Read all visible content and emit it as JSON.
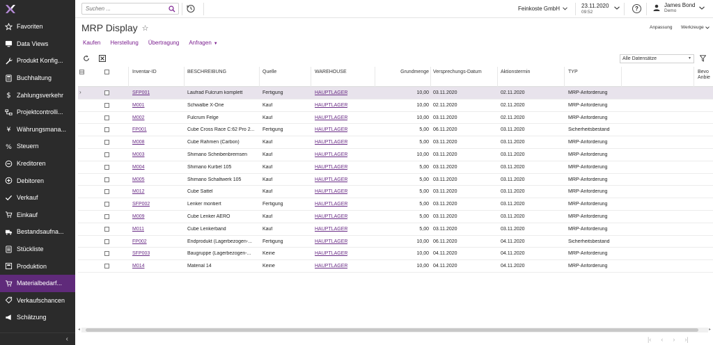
{
  "app": {
    "logo": "X"
  },
  "sidebar": {
    "items": [
      {
        "label": "Favoriten",
        "icon": "star-icon"
      },
      {
        "label": "Data Views",
        "icon": "monitor-icon"
      },
      {
        "label": "Produkt Konfig...",
        "icon": "wrench-icon"
      },
      {
        "label": "Buchhaltung",
        "icon": "calculator-icon"
      },
      {
        "label": "Zahlungsverkehr",
        "icon": "dollar-icon"
      },
      {
        "label": "Projektcontrolli...",
        "icon": "projects-icon"
      },
      {
        "label": "Währungsmana...",
        "icon": "currency-icon"
      },
      {
        "label": "Steuern",
        "icon": "percent-icon"
      },
      {
        "label": "Kreditoren",
        "icon": "minus-circle-icon"
      },
      {
        "label": "Debitoren",
        "icon": "plus-circle-icon"
      },
      {
        "label": "Verkauf",
        "icon": "check-tag-icon"
      },
      {
        "label": "Einkauf",
        "icon": "cart-icon"
      },
      {
        "label": "Bestandsaufna...",
        "icon": "truck-icon"
      },
      {
        "label": "Stückliste",
        "icon": "list-icon"
      },
      {
        "label": "Produktion",
        "icon": "factory-icon"
      },
      {
        "label": "Materialbedarf...",
        "icon": "cart-icon",
        "active": true
      },
      {
        "label": "Verkaufschancen",
        "icon": "tag-icon"
      },
      {
        "label": "Schätzung",
        "icon": "megaphone-icon"
      }
    ],
    "collapse": "‹"
  },
  "topbar": {
    "search_placeholder": "Suchen ...",
    "company": "Feinkoste GmbH",
    "date": "23.11.2020",
    "time": "09:52",
    "help": "?",
    "user_name": "James Bond",
    "user_role": "Demo"
  },
  "page": {
    "title": "MRP Display",
    "star": "☆",
    "links": {
      "customize": "Anpassung",
      "tools": "Werkzeuge"
    },
    "tabs": [
      {
        "label": "Kaufen"
      },
      {
        "label": "Herstellung"
      },
      {
        "label": "Übertragung"
      },
      {
        "label": "Anfragen",
        "dropdown": true
      }
    ],
    "filter_value": "Alle Datensätze"
  },
  "grid": {
    "columns": {
      "inventory_id": "Inventar-ID",
      "description": "BESCHREIBUNG",
      "source": "Quelle",
      "warehouse": "WAREHOUSE",
      "base_qty": "Grundmenge",
      "promise_date": "Versprechungs-Datum",
      "action_date": "Aktionstermin",
      "type": "TYP",
      "pref_line1": "Bevo",
      "pref_line2": "Anbie"
    },
    "rows": [
      {
        "id": "SFP001",
        "desc": "Laufrad Fulcrum komplett",
        "source": "Fertigung",
        "wh": "HAUPTLAGER",
        "qty": "10,00",
        "promise": "03.11.2020",
        "action": "02.11.2020",
        "type": "MRP-Anforderung"
      },
      {
        "id": "M001",
        "desc": "Schwalbe X-One",
        "source": "Kauf",
        "wh": "HAUPTLAGER",
        "qty": "10,00",
        "promise": "02.11.2020",
        "action": "02.11.2020",
        "type": "MRP-Anforderung"
      },
      {
        "id": "M002",
        "desc": "Fulcrum Felge",
        "source": "Kauf",
        "wh": "HAUPTLAGER",
        "qty": "10,00",
        "promise": "03.11.2020",
        "action": "02.11.2020",
        "type": "MRP-Anforderung"
      },
      {
        "id": "FP001",
        "desc": "Cube Cross Race C:62 Pro 2...",
        "source": "Fertigung",
        "wh": "HAUPTLAGER",
        "qty": "5,00",
        "promise": "06.11.2020",
        "action": "03.11.2020",
        "type": "Sicherheitsbestand"
      },
      {
        "id": "M008",
        "desc": "Cube Rahmen (Carbon)",
        "source": "Kauf",
        "wh": "HAUPTLAGER",
        "qty": "5,00",
        "promise": "03.11.2020",
        "action": "03.11.2020",
        "type": "MRP-Anforderung"
      },
      {
        "id": "M003",
        "desc": "Shimano Scheibenbremsen",
        "source": "Kauf",
        "wh": "HAUPTLAGER",
        "qty": "10,00",
        "promise": "03.11.2020",
        "action": "03.11.2020",
        "type": "MRP-Anforderung"
      },
      {
        "id": "M004",
        "desc": "Shimano Kurbel 105",
        "source": "Kauf",
        "wh": "HAUPTLAGER",
        "qty": "5,00",
        "promise": "03.11.2020",
        "action": "03.11.2020",
        "type": "MRP-Anforderung"
      },
      {
        "id": "M005",
        "desc": "Shimano Schaltwerk 105",
        "source": "Kauf",
        "wh": "HAUPTLAGER",
        "qty": "5,00",
        "promise": "03.11.2020",
        "action": "03.11.2020",
        "type": "MRP-Anforderung"
      },
      {
        "id": "M012",
        "desc": "Cube Sattel",
        "source": "Kauf",
        "wh": "HAUPTLAGER",
        "qty": "5,00",
        "promise": "03.11.2020",
        "action": "03.11.2020",
        "type": "MRP-Anforderung"
      },
      {
        "id": "SFP002",
        "desc": "Lenker montiert",
        "source": "Fertigung",
        "wh": "HAUPTLAGER",
        "qty": "5,00",
        "promise": "03.11.2020",
        "action": "03.11.2020",
        "type": "MRP-Anforderung"
      },
      {
        "id": "M009",
        "desc": "Cube Lenker AERO",
        "source": "Kauf",
        "wh": "HAUPTLAGER",
        "qty": "5,00",
        "promise": "03.11.2020",
        "action": "03.11.2020",
        "type": "MRP-Anforderung"
      },
      {
        "id": "M011",
        "desc": "Cube Lenkerband",
        "source": "Kauf",
        "wh": "HAUPTLAGER",
        "qty": "5,00",
        "promise": "03.11.2020",
        "action": "03.11.2020",
        "type": "MRP-Anforderung"
      },
      {
        "id": "FP002",
        "desc": "Endprodukt (Lagerbezogen-...",
        "source": "Fertigung",
        "wh": "HAUPTLAGER",
        "qty": "10,00",
        "promise": "06.11.2020",
        "action": "04.11.2020",
        "type": "Sicherheitsbestand"
      },
      {
        "id": "SFP003",
        "desc": "Baugruppe (Lagerbezogen-...",
        "source": "Keine",
        "wh": "HAUPTLAGER",
        "qty": "10,00",
        "promise": "04.11.2020",
        "action": "04.11.2020",
        "type": "MRP-Anforderung"
      },
      {
        "id": "M014",
        "desc": "Material 14",
        "source": "Keine",
        "wh": "HAUPTLAGER",
        "qty": "10,00",
        "promise": "04.11.2020",
        "action": "04.11.2020",
        "type": "MRP-Anforderung"
      }
    ]
  },
  "colors": {
    "sidebar": "#2b2b2b",
    "accent": "#5f2a7a",
    "link": "#6a2c86",
    "selected_row": "#e8e3ec"
  }
}
